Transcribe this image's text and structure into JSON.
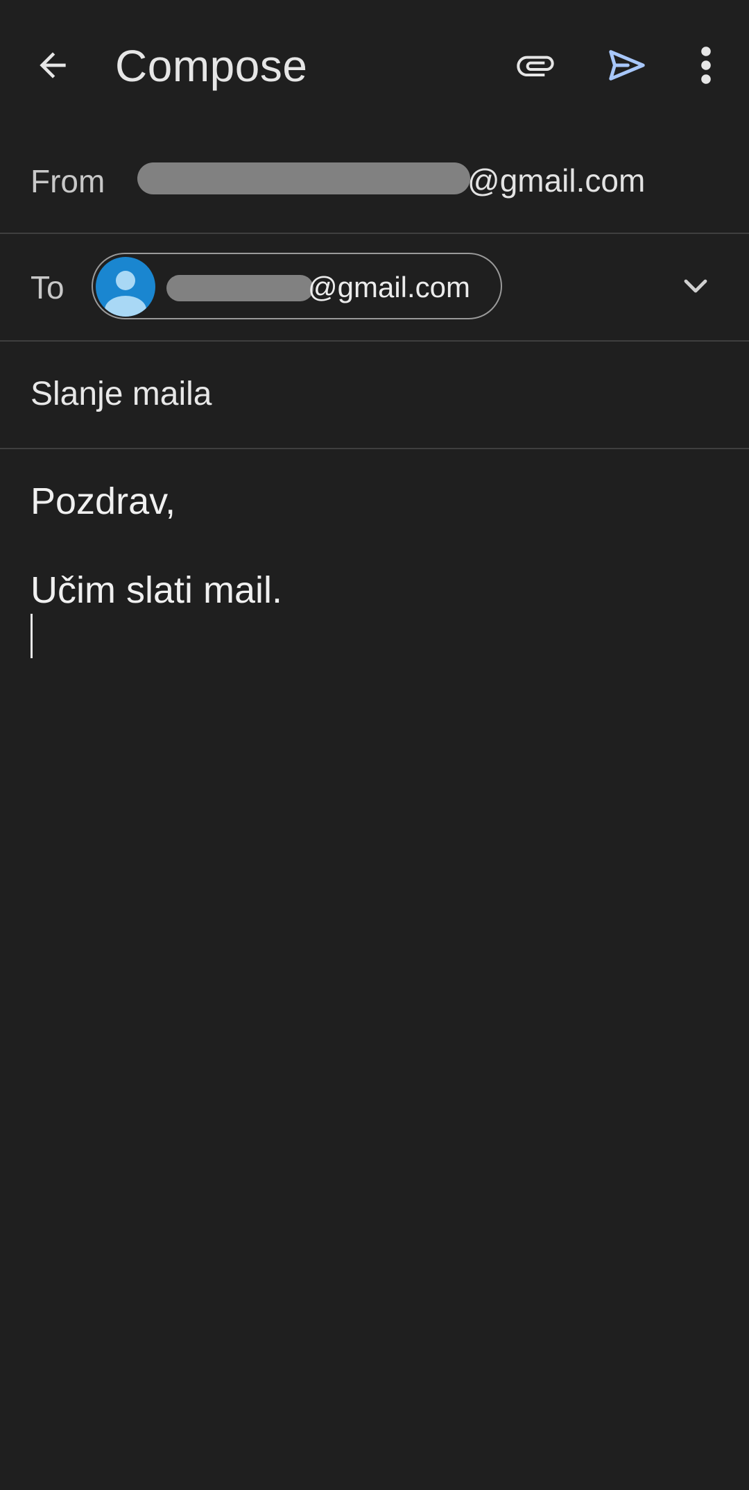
{
  "app": {
    "title": "Compose"
  },
  "toolbar": {
    "back_icon": "arrow-back-icon",
    "attach_icon": "paperclip-icon",
    "send_icon": "send-icon",
    "more_icon": "more-vert-icon",
    "send_color": "#a8c7fa"
  },
  "from": {
    "label": "From",
    "value_visible": "@gmail.com"
  },
  "to": {
    "label": "To",
    "recipient_visible": "@gmail.com",
    "avatar_color": "#1a86d0",
    "expand_icon": "chevron-down-icon"
  },
  "subject": {
    "value": "Slanje maila"
  },
  "body": {
    "line1": "Pozdrav,",
    "line2": "Učim slati mail."
  }
}
